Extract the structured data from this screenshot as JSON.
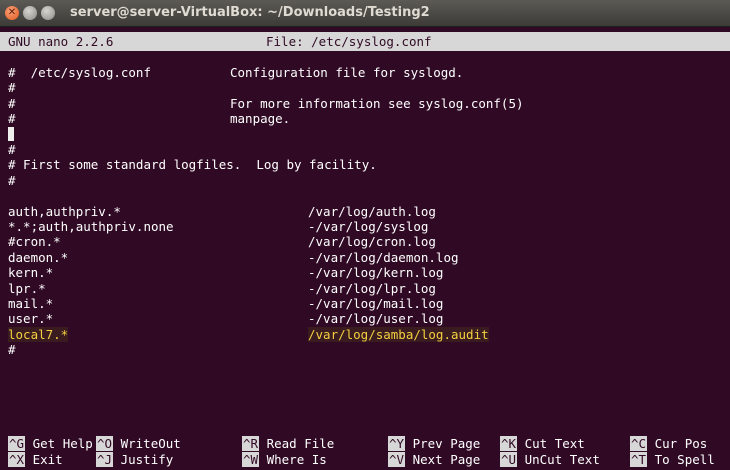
{
  "window": {
    "title": "server@server-VirtualBox: ~/Downloads/Testing2",
    "close_glyph": "✕"
  },
  "nano": {
    "version": "GNU nano 2.2.6",
    "file_label": "File: /etc/syslog.conf"
  },
  "content": {
    "lines": [
      {
        "left": "#  /etc/syslog.conf",
        "right": "Configuration file for syslogd."
      },
      {
        "left": "#",
        "right": ""
      },
      {
        "left": "#",
        "right": "For more information see syslog.conf(5)"
      },
      {
        "left": "#",
        "right": "manpage."
      },
      {
        "left": "",
        "right": ""
      },
      {
        "left": "#",
        "right": ""
      },
      {
        "left": "# First some standard logfiles.  Log by facility.",
        "right": ""
      },
      {
        "left": "#",
        "right": ""
      },
      {
        "left": "",
        "right": ""
      },
      {
        "left": "auth,authpriv.*",
        "right": "/var/log/auth.log"
      },
      {
        "left": "*.*;auth,authpriv.none",
        "right": "-/var/log/syslog"
      },
      {
        "left": "#cron.*",
        "right": "/var/log/cron.log"
      },
      {
        "left": "daemon.*",
        "right": "-/var/log/daemon.log"
      },
      {
        "left": "kern.*",
        "right": "-/var/log/kern.log"
      },
      {
        "left": "lpr.*",
        "right": "-/var/log/lpr.log"
      },
      {
        "left": "mail.*",
        "right": "-/var/log/mail.log"
      },
      {
        "left": "user.*",
        "right": "-/var/log/user.log"
      },
      {
        "left": "local7.*",
        "right": "/var/log/samba/log.audit"
      },
      {
        "left": "#",
        "right": ""
      }
    ]
  },
  "shortcuts": [
    {
      "key": "^G",
      "label": "Get Help"
    },
    {
      "key": "^O",
      "label": "WriteOut"
    },
    {
      "key": "^R",
      "label": "Read File"
    },
    {
      "key": "^Y",
      "label": "Prev Page"
    },
    {
      "key": "^K",
      "label": "Cut Text"
    },
    {
      "key": "^C",
      "label": "Cur Pos"
    },
    {
      "key": "^X",
      "label": "Exit"
    },
    {
      "key": "^J",
      "label": "Justify"
    },
    {
      "key": "^W",
      "label": "Where Is"
    },
    {
      "key": "^V",
      "label": "Next Page"
    },
    {
      "key": "^U",
      "label": "UnCut Text"
    },
    {
      "key": "^T",
      "label": "To Spell"
    }
  ],
  "colors": {
    "terminal_bg": "#300a24",
    "highlight_text": "#f4d03f",
    "header_bg": "#d7d7d7"
  }
}
